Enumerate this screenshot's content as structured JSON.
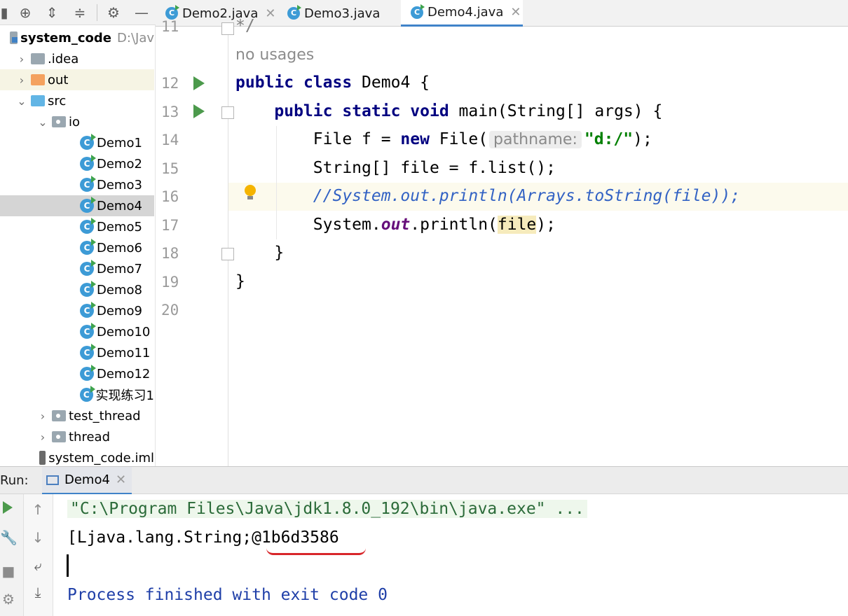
{
  "tabs": [
    {
      "label": "Demo2.java",
      "active": false
    },
    {
      "label": "Demo3.java",
      "active": false
    },
    {
      "label": "Demo4.java",
      "active": true
    }
  ],
  "project": {
    "root_name": "system_code",
    "root_path": "D:\\Jav",
    "idea": ".idea",
    "out": "out",
    "src": "src",
    "io": "io",
    "files": [
      "Demo1",
      "Demo2",
      "Demo3",
      "Demo4",
      "Demo5",
      "Demo6",
      "Demo7",
      "Demo8",
      "Demo9",
      "Demo10",
      "Demo11",
      "Demo12",
      "实现练习1"
    ],
    "test_thread": "test_thread",
    "thread": "thread",
    "iml": "system_code.iml"
  },
  "editor": {
    "line_numbers": [
      "11",
      "12",
      "13",
      "14",
      "15",
      "16",
      "17",
      "18",
      "19",
      "20"
    ],
    "top_fragment": "*/",
    "no_usages": "no usages",
    "l12": {
      "kw1": "public",
      "kw2": "class",
      "rest": " Demo4 {"
    },
    "l13": {
      "kw1": "public",
      "kw2": "static",
      "kw3": "void",
      "rest": " main(String[] args) {"
    },
    "l14": {
      "pre": "File f = ",
      "kw": "new",
      "mid": " File(",
      "hint": "pathname:",
      "str": "\"d:/\"",
      "post": ");"
    },
    "l15": "String[] file = f.list();",
    "l16": "//System.out.println(Arrays.toString(file));",
    "l17": {
      "pre": "System.",
      "field": "out",
      "mid": ".println(",
      "var": "file",
      "post": ");"
    },
    "l18": "}",
    "l19": "}"
  },
  "run": {
    "label": "Run:",
    "tab": "Demo4",
    "cmd": "\"C:\\Program Files\\Java\\jdk1.8.0_192\\bin\\java.exe\" ...",
    "output": "[Ljava.lang.String;@1b6d3586",
    "exit": "Process finished with exit code 0"
  },
  "colors": {
    "keyword": "#000080",
    "string": "#008000",
    "comment": "#3262c4",
    "static_field": "#660e7a",
    "accent": "#4083c9",
    "run_green": "#4c9a4c",
    "annotation_red": "#d8262a"
  }
}
